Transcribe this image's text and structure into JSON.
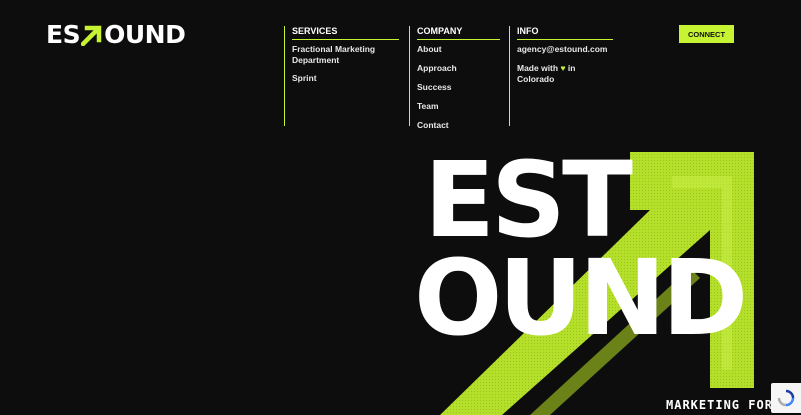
{
  "brand": {
    "logo_left": "ES",
    "logo_right": "OUND",
    "accent": "#c6f432",
    "background": "#0d0d0d"
  },
  "nav": {
    "services": {
      "title": "SERVICES",
      "items": [
        "Fractional Marketing Department",
        "Sprint"
      ]
    },
    "company": {
      "title": "COMPANY",
      "items": [
        "About",
        "Approach",
        "Success",
        "Team",
        "Contact"
      ]
    },
    "info": {
      "title": "INFO",
      "email": "agency@estound.com",
      "made_prefix": "Made with",
      "made_icon": "heart-icon",
      "made_suffix": "in Colorado"
    }
  },
  "cta": {
    "label": "CONNECT"
  },
  "hero": {
    "line1": "EST",
    "line2": "OUND",
    "tagline": "MARKETING FOR"
  },
  "recaptcha": {
    "icon": "recaptcha-icon"
  }
}
